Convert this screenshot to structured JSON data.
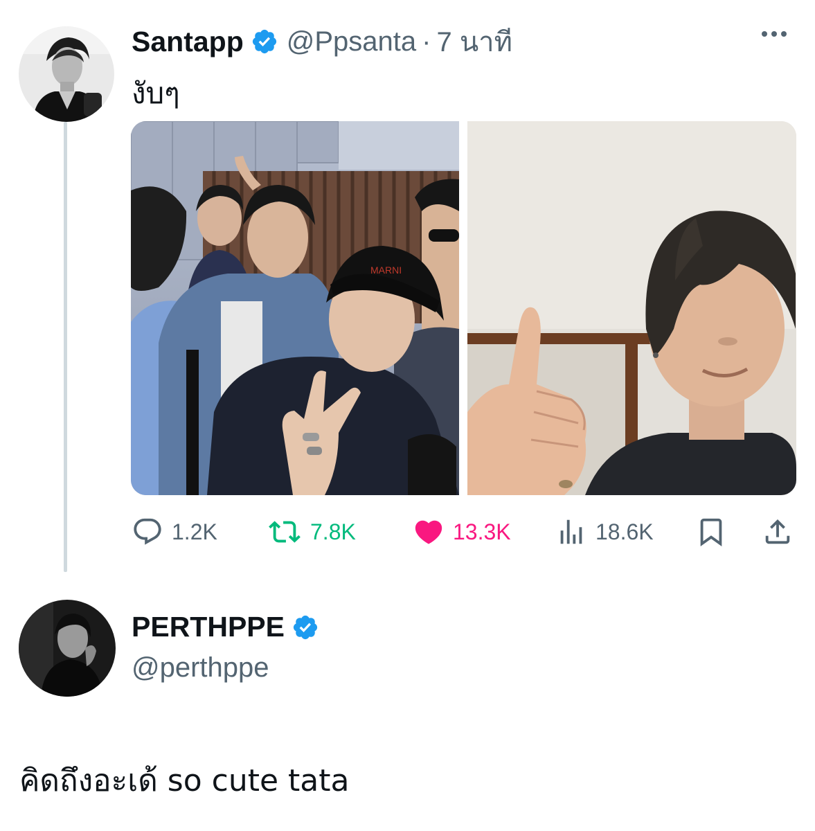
{
  "tweet": {
    "author_name": "Santapp",
    "author_handle": "@Ppsanta",
    "separator": "·",
    "timestamp": "7 นาที",
    "text": "งับๆ",
    "stats": {
      "replies": "1.2K",
      "retweets": "7.8K",
      "likes": "13.3K",
      "views": "18.6K"
    }
  },
  "reply": {
    "author_name": "PERTHPPE",
    "author_handle": "@perthppe",
    "text": "คิดถึงอะเด้ so cute tata"
  },
  "icons": {
    "verified": "verified-badge-icon",
    "more": "more-options-icon",
    "reply": "reply-icon",
    "retweet": "retweet-icon",
    "like": "heart-icon",
    "views": "views-icon",
    "bookmark": "bookmark-icon",
    "share": "share-icon"
  },
  "colors": {
    "verified": "#1d9bf0",
    "retweet": "#00ba7c",
    "like": "#f91880",
    "muted": "#536471",
    "thread_line": "#cfd9de"
  }
}
